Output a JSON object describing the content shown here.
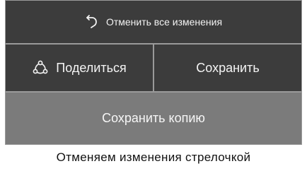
{
  "menu": {
    "undo_label": "Отменить все изменения",
    "undo_icon": "undo-arrow-icon",
    "share_label": "Поделиться",
    "share_icon": "share-icon",
    "save_label": "Сохранить",
    "save_copy_label": "Сохранить копию"
  },
  "caption": "Отменяем изменения стрелочкой",
  "colors": {
    "dark_button": "#3c3c3c",
    "highlighted_button": "#7b7b7b",
    "divider": "#9a9a9a",
    "text": "#f4f4f4"
  }
}
